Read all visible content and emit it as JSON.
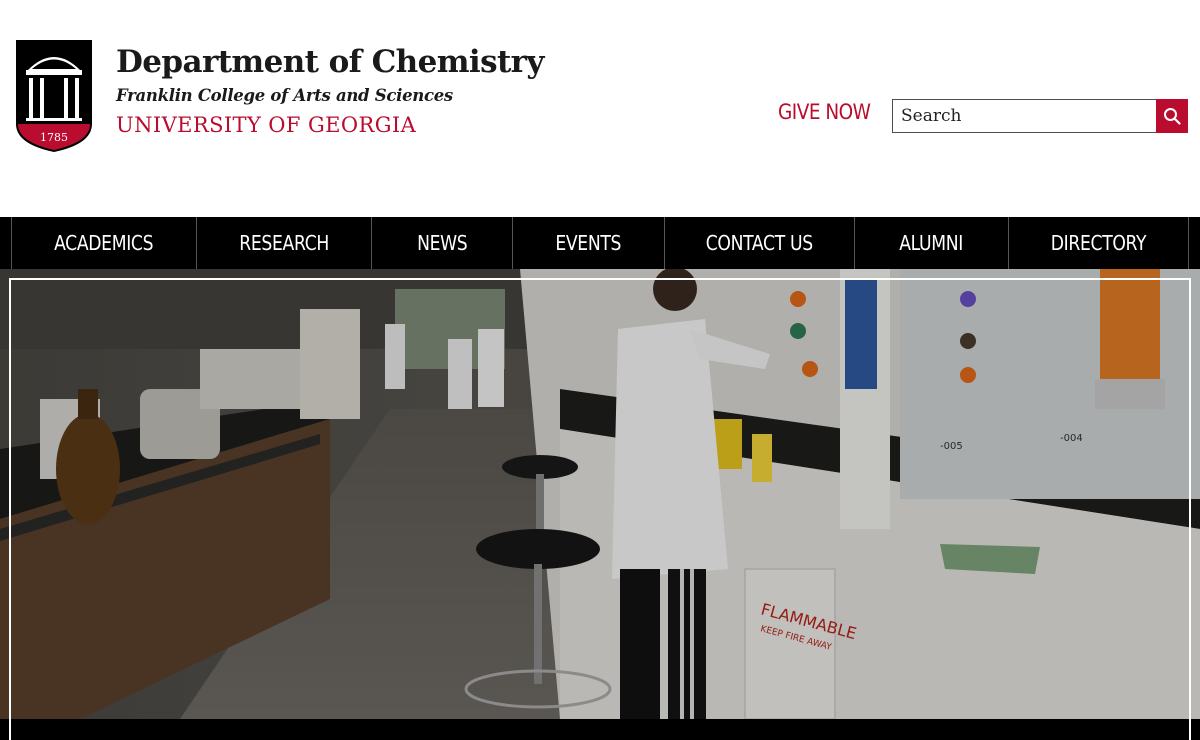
{
  "header": {
    "department": "Department of Chemistry",
    "college": "Franklin College of Arts and Sciences",
    "university": "UNIVERSITY OF GEORGIA",
    "logo_year": "1785",
    "give_now": "GIVE NOW",
    "search": {
      "placeholder": "Search",
      "value": ""
    }
  },
  "nav": {
    "items": [
      {
        "label": "ACADEMICS"
      },
      {
        "label": "RESEARCH"
      },
      {
        "label": "NEWS"
      },
      {
        "label": "EVENTS"
      },
      {
        "label": "CONTACT US"
      },
      {
        "label": "ALUMNI"
      },
      {
        "label": "DIRECTORY"
      }
    ]
  },
  "hero": {
    "signage": {
      "flammable": "FLAMMABLE",
      "keep_fire_away": "KEEP FIRE AWAY",
      "label_005": "-005",
      "label_004": "-004"
    }
  },
  "colors": {
    "brand_red": "#ba0c2f",
    "nav_bg": "#000000",
    "text": "#1a1a1a"
  },
  "icons": {
    "search": "search-icon",
    "logo": "arch-shield-logo"
  }
}
